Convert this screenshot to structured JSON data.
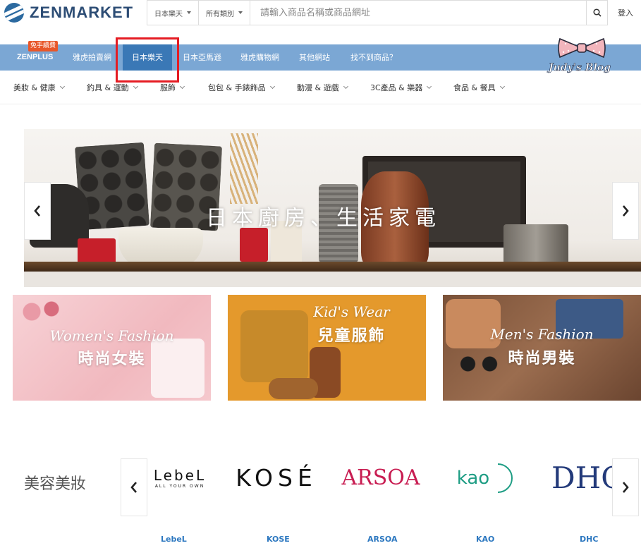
{
  "header": {
    "logo_text": "ZENMARKET",
    "search_store": "日本樂天",
    "search_category": "所有類別",
    "search_placeholder": "請輸入商品名稱或商品網址",
    "login": "登入"
  },
  "nav": {
    "badge": "免手續費",
    "items": [
      "ZENPLUS",
      "雅虎拍賣網",
      "日本樂天",
      "日本亞馬遜",
      "雅虎購物網",
      "其他網站",
      "找不到商品？"
    ],
    "active": "日本樂天"
  },
  "watermark": {
    "blog": "Judy's Blog"
  },
  "categories": [
    "美妝 & 健康",
    "釣具 & 運動",
    "服飾",
    "包包 & 手錶飾品",
    "動漫 & 遊戲",
    "3C產品 & 樂器",
    "食品 & 餐具"
  ],
  "hero": {
    "title": "日本廚房、生活家電"
  },
  "tiles": [
    {
      "en": "Women's Fashion",
      "zh": "時尚女裝",
      "bg": "#f4c6cb"
    },
    {
      "en": "Kid's Wear",
      "zh": "兒童服飾",
      "bg": "#e59a2d"
    },
    {
      "en": "Men's Fashion",
      "zh": "時尚男裝",
      "bg": "#8a5a40"
    }
  ],
  "brands": {
    "heading": "美容美妝",
    "items": [
      {
        "logo": "LebeL",
        "tagline": "ALL YOUR OWN",
        "name": "LebeL"
      },
      {
        "logo": "KOSÉ",
        "name": "KOSE"
      },
      {
        "logo": "ARSOA",
        "name": "ARSOA"
      },
      {
        "logo": "kao",
        "name": "KAO"
      },
      {
        "logo": "DHC",
        "name": "DHC"
      }
    ]
  },
  "colors": {
    "nav_bg": "#7ba7d4",
    "nav_active": "#3a78b6",
    "badge": "#e8572a",
    "link": "#2d78c0",
    "highlight": "#e51c23"
  }
}
